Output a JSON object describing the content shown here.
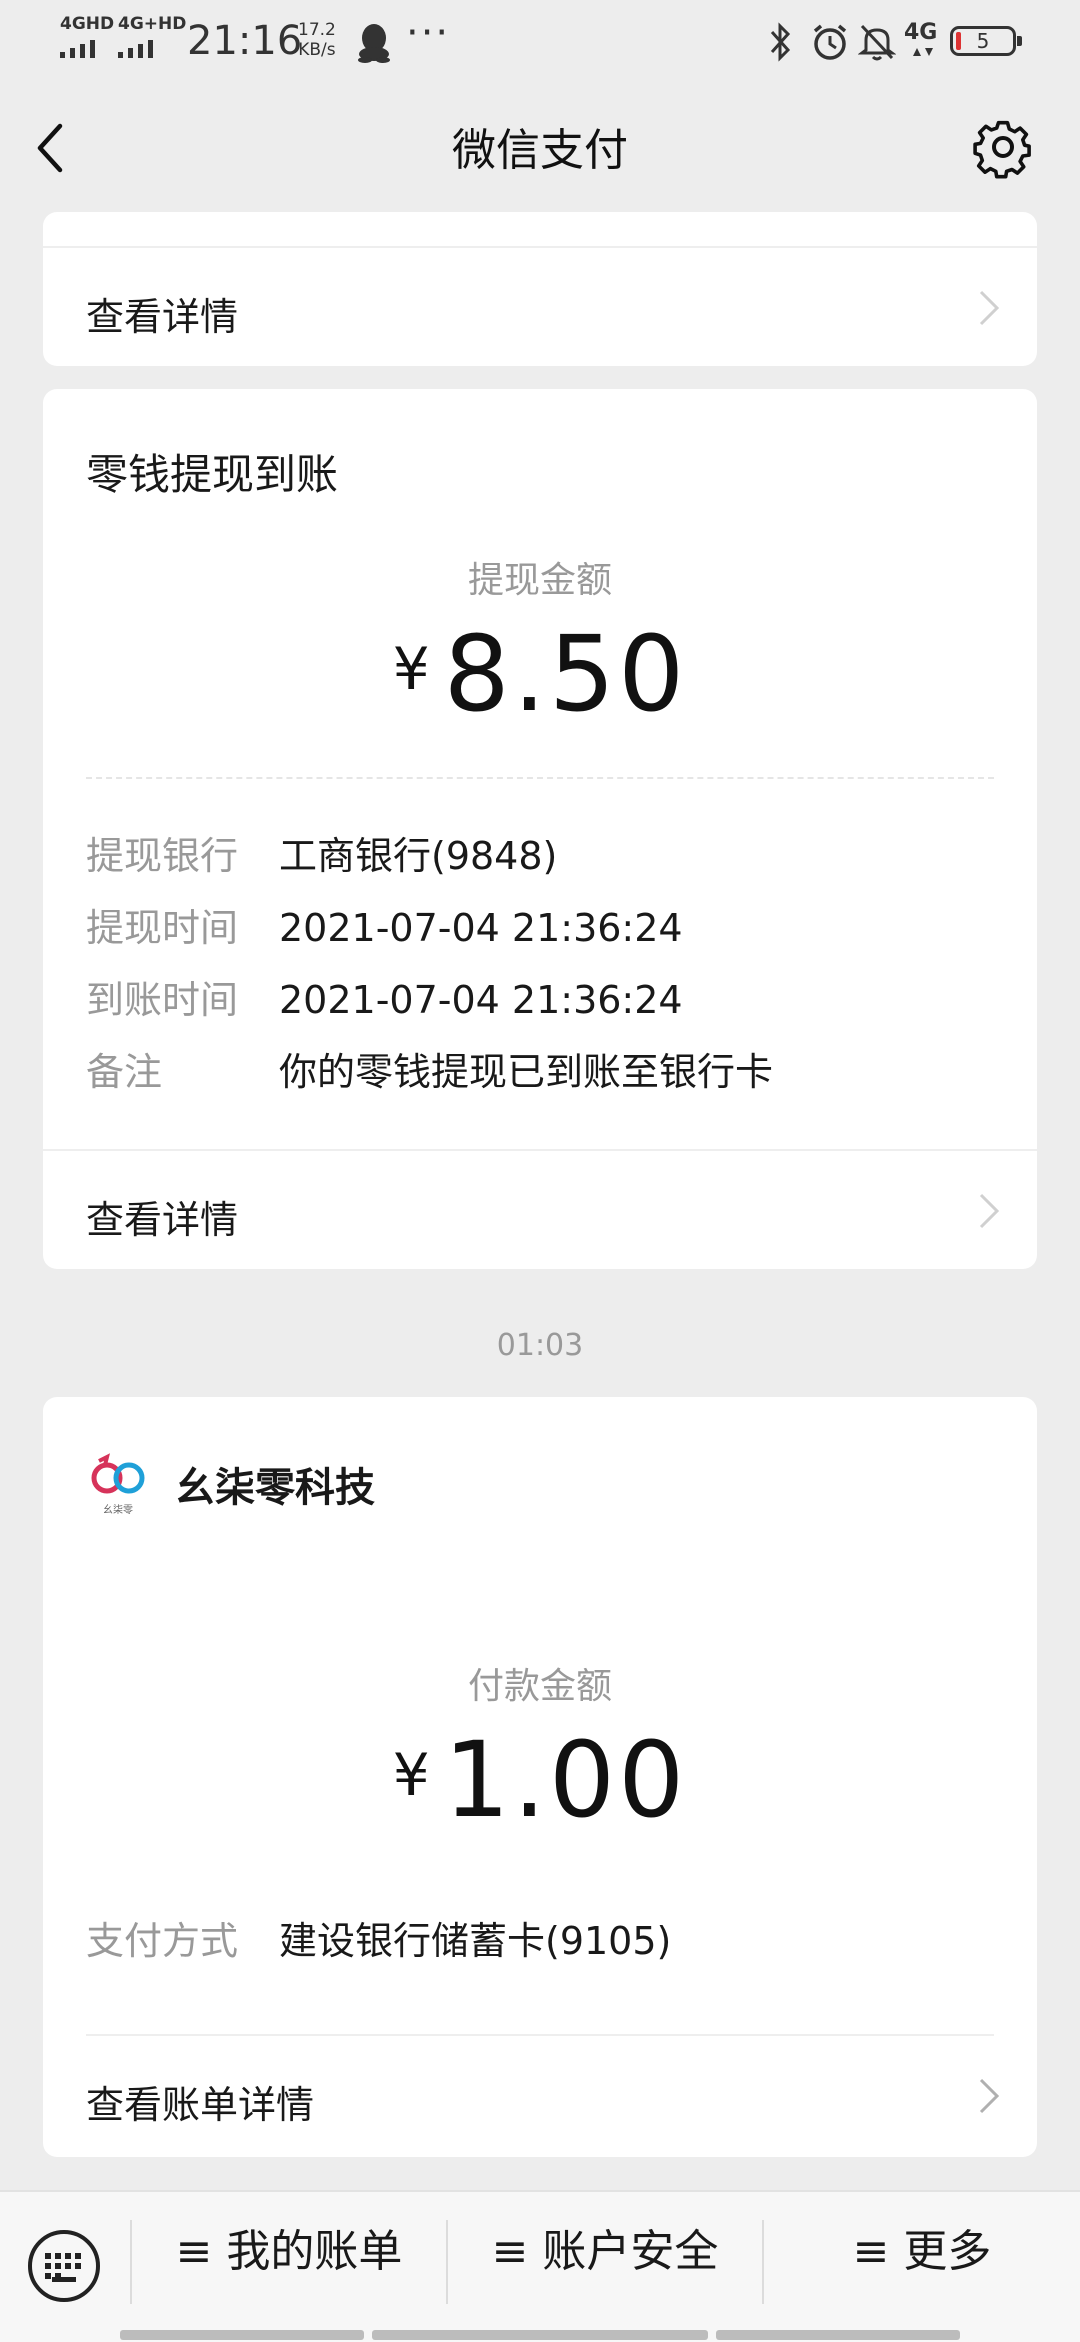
{
  "status_bar": {
    "net1": "4GHD",
    "net2": "4G+HD",
    "time": "21:16",
    "speed_value": "17.2",
    "speed_unit": "KB/s",
    "right_net": "4G",
    "battery": "5"
  },
  "nav": {
    "title": "微信支付"
  },
  "top_card": {
    "link_label": "查看详情"
  },
  "withdraw_card": {
    "title": "零钱提现到账",
    "amount_label": "提现金额",
    "currency": "¥",
    "amount": "8.50",
    "details": [
      {
        "key": "提现银行",
        "value": "工商银行(9848)"
      },
      {
        "key": "提现时间",
        "value": "2021-07-04 21:36:24"
      },
      {
        "key": "到账时间",
        "value": "2021-07-04 21:36:24"
      },
      {
        "key": "备注",
        "value": "你的零钱提现已到账至银行卡"
      }
    ],
    "link_label": "查看详情"
  },
  "timestamp": "01:03",
  "payment_card": {
    "merchant": "幺柒零科技",
    "logo_caption": "幺柒零",
    "amount_label": "付款金额",
    "currency": "¥",
    "amount": "1.00",
    "method_key": "支付方式",
    "method_value": "建设银行储蓄卡(9105)",
    "link_label": "查看账单详情"
  },
  "bottom_bar": {
    "tabs": [
      {
        "label": "≡ 我的账单"
      },
      {
        "label": "≡ 账户安全"
      },
      {
        "label": "≡ 更多"
      }
    ]
  },
  "colors": {
    "background": "#ededed",
    "card": "#ffffff",
    "secondary_text": "#999999"
  }
}
